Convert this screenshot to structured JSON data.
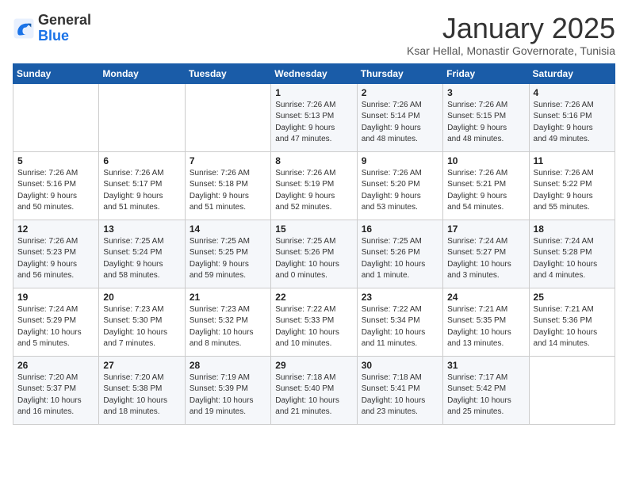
{
  "header": {
    "logo_general": "General",
    "logo_blue": "Blue",
    "month": "January 2025",
    "location": "Ksar Hellal, Monastir Governorate, Tunisia"
  },
  "weekdays": [
    "Sunday",
    "Monday",
    "Tuesday",
    "Wednesday",
    "Thursday",
    "Friday",
    "Saturday"
  ],
  "weeks": [
    [
      {
        "day": "",
        "info": ""
      },
      {
        "day": "",
        "info": ""
      },
      {
        "day": "",
        "info": ""
      },
      {
        "day": "1",
        "info": "Sunrise: 7:26 AM\nSunset: 5:13 PM\nDaylight: 9 hours\nand 47 minutes."
      },
      {
        "day": "2",
        "info": "Sunrise: 7:26 AM\nSunset: 5:14 PM\nDaylight: 9 hours\nand 48 minutes."
      },
      {
        "day": "3",
        "info": "Sunrise: 7:26 AM\nSunset: 5:15 PM\nDaylight: 9 hours\nand 48 minutes."
      },
      {
        "day": "4",
        "info": "Sunrise: 7:26 AM\nSunset: 5:16 PM\nDaylight: 9 hours\nand 49 minutes."
      }
    ],
    [
      {
        "day": "5",
        "info": "Sunrise: 7:26 AM\nSunset: 5:16 PM\nDaylight: 9 hours\nand 50 minutes."
      },
      {
        "day": "6",
        "info": "Sunrise: 7:26 AM\nSunset: 5:17 PM\nDaylight: 9 hours\nand 51 minutes."
      },
      {
        "day": "7",
        "info": "Sunrise: 7:26 AM\nSunset: 5:18 PM\nDaylight: 9 hours\nand 51 minutes."
      },
      {
        "day": "8",
        "info": "Sunrise: 7:26 AM\nSunset: 5:19 PM\nDaylight: 9 hours\nand 52 minutes."
      },
      {
        "day": "9",
        "info": "Sunrise: 7:26 AM\nSunset: 5:20 PM\nDaylight: 9 hours\nand 53 minutes."
      },
      {
        "day": "10",
        "info": "Sunrise: 7:26 AM\nSunset: 5:21 PM\nDaylight: 9 hours\nand 54 minutes."
      },
      {
        "day": "11",
        "info": "Sunrise: 7:26 AM\nSunset: 5:22 PM\nDaylight: 9 hours\nand 55 minutes."
      }
    ],
    [
      {
        "day": "12",
        "info": "Sunrise: 7:26 AM\nSunset: 5:23 PM\nDaylight: 9 hours\nand 56 minutes."
      },
      {
        "day": "13",
        "info": "Sunrise: 7:25 AM\nSunset: 5:24 PM\nDaylight: 9 hours\nand 58 minutes."
      },
      {
        "day": "14",
        "info": "Sunrise: 7:25 AM\nSunset: 5:25 PM\nDaylight: 9 hours\nand 59 minutes."
      },
      {
        "day": "15",
        "info": "Sunrise: 7:25 AM\nSunset: 5:26 PM\nDaylight: 10 hours\nand 0 minutes."
      },
      {
        "day": "16",
        "info": "Sunrise: 7:25 AM\nSunset: 5:26 PM\nDaylight: 10 hours\nand 1 minute."
      },
      {
        "day": "17",
        "info": "Sunrise: 7:24 AM\nSunset: 5:27 PM\nDaylight: 10 hours\nand 3 minutes."
      },
      {
        "day": "18",
        "info": "Sunrise: 7:24 AM\nSunset: 5:28 PM\nDaylight: 10 hours\nand 4 minutes."
      }
    ],
    [
      {
        "day": "19",
        "info": "Sunrise: 7:24 AM\nSunset: 5:29 PM\nDaylight: 10 hours\nand 5 minutes."
      },
      {
        "day": "20",
        "info": "Sunrise: 7:23 AM\nSunset: 5:30 PM\nDaylight: 10 hours\nand 7 minutes."
      },
      {
        "day": "21",
        "info": "Sunrise: 7:23 AM\nSunset: 5:32 PM\nDaylight: 10 hours\nand 8 minutes."
      },
      {
        "day": "22",
        "info": "Sunrise: 7:22 AM\nSunset: 5:33 PM\nDaylight: 10 hours\nand 10 minutes."
      },
      {
        "day": "23",
        "info": "Sunrise: 7:22 AM\nSunset: 5:34 PM\nDaylight: 10 hours\nand 11 minutes."
      },
      {
        "day": "24",
        "info": "Sunrise: 7:21 AM\nSunset: 5:35 PM\nDaylight: 10 hours\nand 13 minutes."
      },
      {
        "day": "25",
        "info": "Sunrise: 7:21 AM\nSunset: 5:36 PM\nDaylight: 10 hours\nand 14 minutes."
      }
    ],
    [
      {
        "day": "26",
        "info": "Sunrise: 7:20 AM\nSunset: 5:37 PM\nDaylight: 10 hours\nand 16 minutes."
      },
      {
        "day": "27",
        "info": "Sunrise: 7:20 AM\nSunset: 5:38 PM\nDaylight: 10 hours\nand 18 minutes."
      },
      {
        "day": "28",
        "info": "Sunrise: 7:19 AM\nSunset: 5:39 PM\nDaylight: 10 hours\nand 19 minutes."
      },
      {
        "day": "29",
        "info": "Sunrise: 7:18 AM\nSunset: 5:40 PM\nDaylight: 10 hours\nand 21 minutes."
      },
      {
        "day": "30",
        "info": "Sunrise: 7:18 AM\nSunset: 5:41 PM\nDaylight: 10 hours\nand 23 minutes."
      },
      {
        "day": "31",
        "info": "Sunrise: 7:17 AM\nSunset: 5:42 PM\nDaylight: 10 hours\nand 25 minutes."
      },
      {
        "day": "",
        "info": ""
      }
    ]
  ]
}
